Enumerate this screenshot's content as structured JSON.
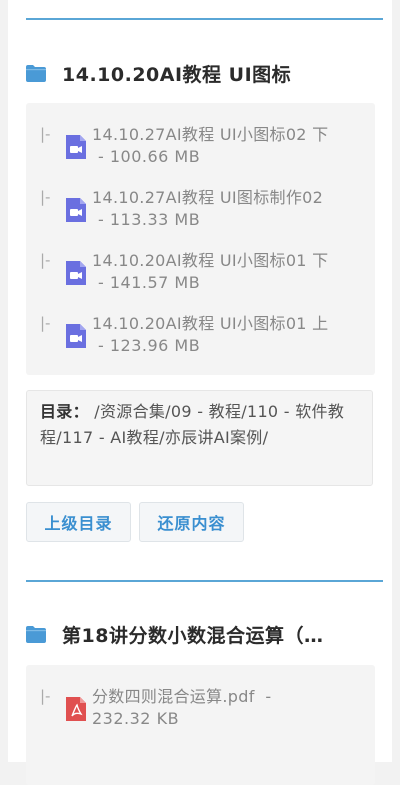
{
  "sections": [
    {
      "title": "14.10.20AI教程 UI图标",
      "files": [
        {
          "name": "14.10.27AI教程 UI小图标02 下",
          "size": "- 100.66 MB",
          "type": "video"
        },
        {
          "name": "14.10.27AI教程 UI图标制作02",
          "size": "- 113.33 MB",
          "type": "video"
        },
        {
          "name": "14.10.20AI教程 UI小图标01 下",
          "size": "- 141.57 MB",
          "type": "video"
        },
        {
          "name": "14.10.20AI教程 UI小图标01 上",
          "size": "- 123.96 MB",
          "type": "video"
        }
      ],
      "directory_label": "目录：",
      "directory_path": " /资源合集/09 - 教程/110 - 软件教程/117 - AI教程/亦辰讲AI案例/",
      "buttons": {
        "parent": "上级目录",
        "restore": "还原内容"
      }
    },
    {
      "title": "第18讲分数小数混合运算（…",
      "files": [
        {
          "name": "分数四则混合运算.pdf",
          "size": "232.32 KB",
          "type": "pdf"
        }
      ]
    }
  ],
  "pipe_glyph": "|-",
  "colors": {
    "accent": "#3a8fd0",
    "folder": "#4a9ad6",
    "video_icon": "#6a6fe0",
    "pdf_icon": "#e05050"
  }
}
